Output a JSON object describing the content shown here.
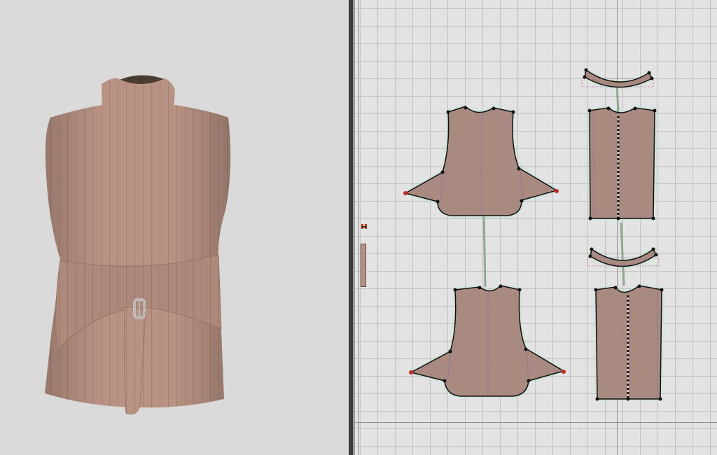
{
  "views": {
    "left": "3d-garment-viewport",
    "right": "2d-pattern-window"
  },
  "garment": {
    "style": "sleeveless mock-neck top with wrap belt and buckle",
    "fabric_color": "#b89283",
    "stripe_color": "#9c7566",
    "buckle": "metal-buckle-icon"
  },
  "pattern_window": {
    "pieces": [
      "collar-front",
      "front-bodice",
      "front-panel",
      "collar-back",
      "back-bodice",
      "back-panel",
      "belt-strip"
    ],
    "colors": {
      "piece_fill": "#a88a80",
      "seam_glow": "#a8e6c4",
      "point": "#111111",
      "selected_point": "#cc2a1a",
      "sewing_line": "#8fa88f"
    }
  }
}
